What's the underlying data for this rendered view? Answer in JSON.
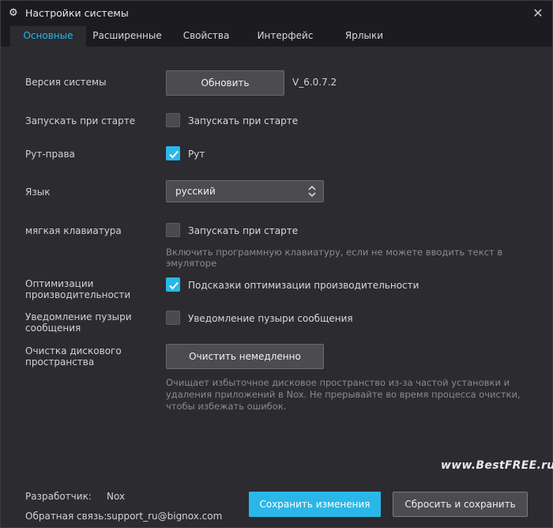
{
  "window": {
    "title": "Настройки системы",
    "icon": "gear-icon"
  },
  "tabs": [
    {
      "label": "Основные",
      "active": true
    },
    {
      "label": "Расширенные",
      "active": false
    },
    {
      "label": "Свойства",
      "active": false
    },
    {
      "label": "Интерфейс",
      "active": false
    },
    {
      "label": "Ярлыки",
      "active": false
    }
  ],
  "settings": {
    "version": {
      "label": "Версия системы",
      "button": "Обновить",
      "value": "V_6.0.7.2"
    },
    "autostart": {
      "label": "Запускать при старте",
      "checkbox_label": "Запускать при старте",
      "checked": false
    },
    "root": {
      "label": "Рут-права",
      "checkbox_label": "Рут",
      "checked": true
    },
    "language": {
      "label": "Язык",
      "selected": "русский"
    },
    "soft_keyboard": {
      "label": "мягкая клавиатура",
      "checkbox_label": "Запускать при старте",
      "checked": false,
      "hint_line1": "Включить программную клавиатуру, если не можете вводить текст в",
      "hint_line2": "эмуляторе"
    },
    "performance": {
      "label_line1": "Оптимизации",
      "label_line2": "производительности",
      "checkbox_label": "Подсказки оптимизации производительности",
      "checked": true
    },
    "bubble": {
      "label_line1": "Уведомление пузыри",
      "label_line2": "сообщения",
      "checkbox_label": "Уведомление пузыри сообщения",
      "checked": false
    },
    "disk_cleanup": {
      "label_line1": "Очистка дискового",
      "label_line2": "пространства",
      "button": "Очистить немедленно",
      "hint_line1": "Очищает избыточное дисковое пространство из-за частой установки и",
      "hint_line2": "удаления приложений в Nox. Не прерывайте во время процесса очистки,",
      "hint_line3": "чтобы избежать ошибок."
    }
  },
  "footer": {
    "developer_label": "Разработчик:",
    "developer_value": "Nox",
    "feedback_label": "Обратная связь:",
    "feedback_value": "support_ru@bignox.com",
    "save_button": "Сохранить изменения",
    "reset_button": "Сбросить и сохранить"
  },
  "watermark": "www.BestFREE.ru",
  "colors": {
    "accent": "#2ab7e8",
    "background": "#2b2b30",
    "titlebar": "#1c1c20"
  }
}
